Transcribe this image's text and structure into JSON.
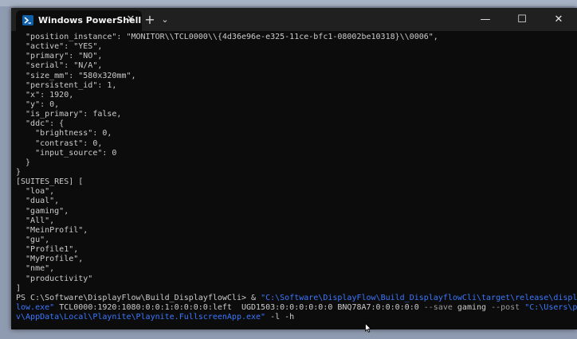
{
  "window": {
    "tab_title": "Windows PowerShell",
    "tab_icon": "powershell-icon",
    "close_tab_symbol": "✕",
    "new_tab_symbol": "+",
    "dropdown_symbol": "⌄",
    "minimize_symbol": "—",
    "maximize_symbol": "☐",
    "close_symbol": "✕"
  },
  "terminal": {
    "lines": [
      "  \"position_instance\": \"MONITOR\\\\TCL0000\\\\{4d36e96e-e325-11ce-bfc1-08002be10318}\\\\0006\",",
      "  \"active\": \"YES\",",
      "  \"primary\": \"NO\",",
      "  \"serial\": \"N/A\",",
      "  \"size_mm\": \"580x320mm\",",
      "  \"persistent_id\": 1,",
      "  \"x\": 1920,",
      "  \"y\": 0,",
      "  \"is_primary\": false,",
      "  \"ddc\": {",
      "    \"brightness\": 0,",
      "    \"contrast\": 0,",
      "    \"input_source\": 0",
      "  }",
      "}",
      "[SUITES_RES] [",
      "  \"loa\",",
      "  \"dual\",",
      "  \"gaming\",",
      "  \"All\",",
      "  \"MeinProfil\",",
      "  \"gu\",",
      "  \"Profile1\",",
      "  \"MyProfile\",",
      "  \"nme\",",
      "  \"productivity\"",
      "]"
    ],
    "prompt": "PS C:\\Software\\DisplayFlow\\Build_DisplayflowCli> ",
    "cmd_op": "& ",
    "cmd_path_a": "\"C:\\Software\\DisplayFlow\\Build_DisplayflowCli\\target\\release\\displayf",
    "cmd_path_b": "low.exe\"",
    "cmd_args_a": " TCL0000:1920:1080:0:0:1:0:0:0:0:left  UGD1503:0:0:0:0:0:0 BNQ78A7:0:0:0:0:0 ",
    "cmd_save": "--save",
    "cmd_args_b": " gaming ",
    "cmd_post": "--post",
    "cmd_space": " ",
    "cmd_path_c": "\"C:\\Users\\piot",
    "cmd_path_d": "v\\AppData\\Local\\Playnite\\Playnite.FullscreenApp.exe\"",
    "cmd_tail": " -l -h"
  }
}
